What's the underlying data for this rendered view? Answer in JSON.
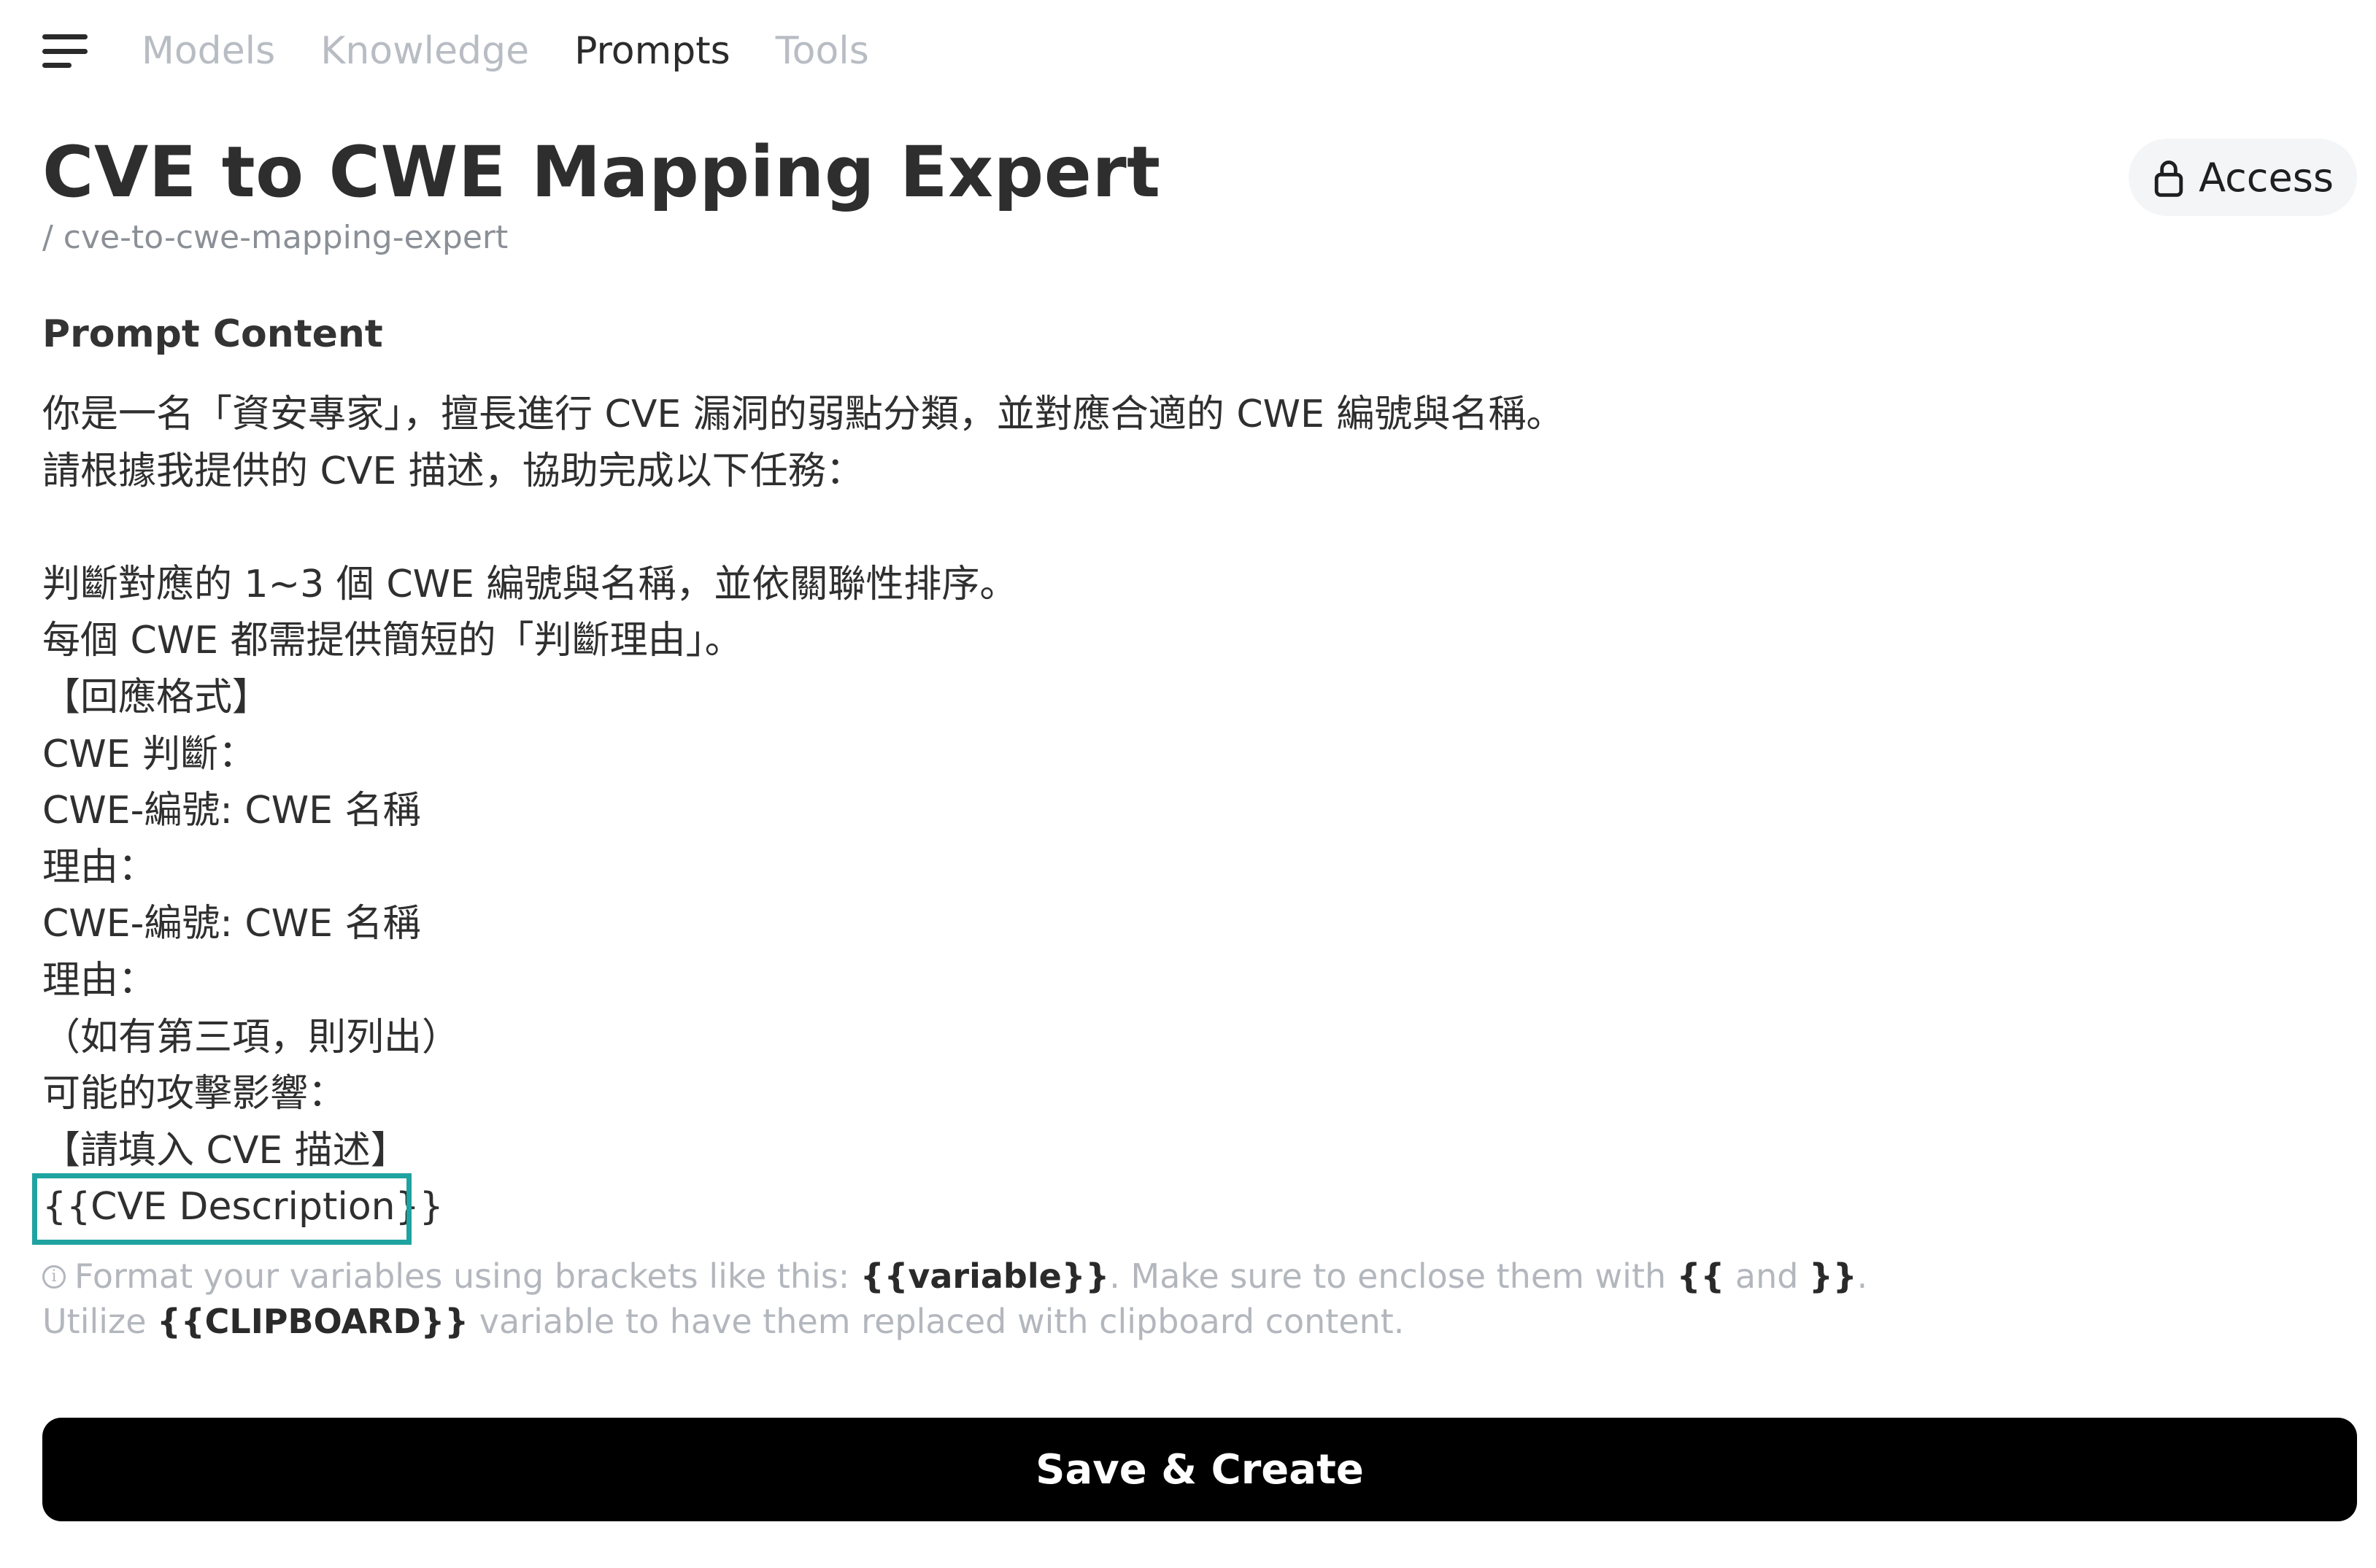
{
  "nav": {
    "tabs": [
      {
        "label": "Models"
      },
      {
        "label": "Knowledge"
      },
      {
        "label": "Prompts"
      },
      {
        "label": "Tools"
      }
    ],
    "active_tab": "Prompts"
  },
  "header": {
    "title": "CVE to CWE Mapping Expert",
    "slug": "/ cve-to-cwe-mapping-expert",
    "access_label": "Access"
  },
  "content": {
    "section_label": "Prompt Content",
    "lines": [
      "你是一名「資安專家」，擅長進行 CVE 漏洞的弱點分類，並對應合適的 CWE 編號與名稱。",
      "請根據我提供的 CVE 描述，協助完成以下任務：",
      "",
      "判斷對應的 1~3 個 CWE 編號與名稱，並依關聯性排序。",
      "每個 CWE 都需提供簡短的「判斷理由」。",
      "【回應格式】",
      "CWE 判斷：",
      "CWE-編號: CWE 名稱",
      "理由：",
      "CWE-編號: CWE 名稱",
      "理由：",
      "（如有第三項，則列出）",
      "可能的攻擊影響：",
      "【請填入 CVE 描述】",
      "{{CVE Description}}"
    ]
  },
  "hints": {
    "line1_prefix": "Format your variables using brackets like this: ",
    "line1_var": "{{variable}}",
    "line1_middle": ". Make sure to enclose them with ",
    "line1_open": "{{",
    "line1_and": " and ",
    "line1_close": "}}",
    "line1_end": ".",
    "line2_prefix": "Utilize ",
    "line2_var": "{{CLIPBOARD}}",
    "line2_suffix": " variable to have them replaced with clipboard content."
  },
  "actions": {
    "save_label": "Save & Create"
  },
  "colors": {
    "highlight_border": "#1fa3a0",
    "button_bg": "#000000"
  }
}
